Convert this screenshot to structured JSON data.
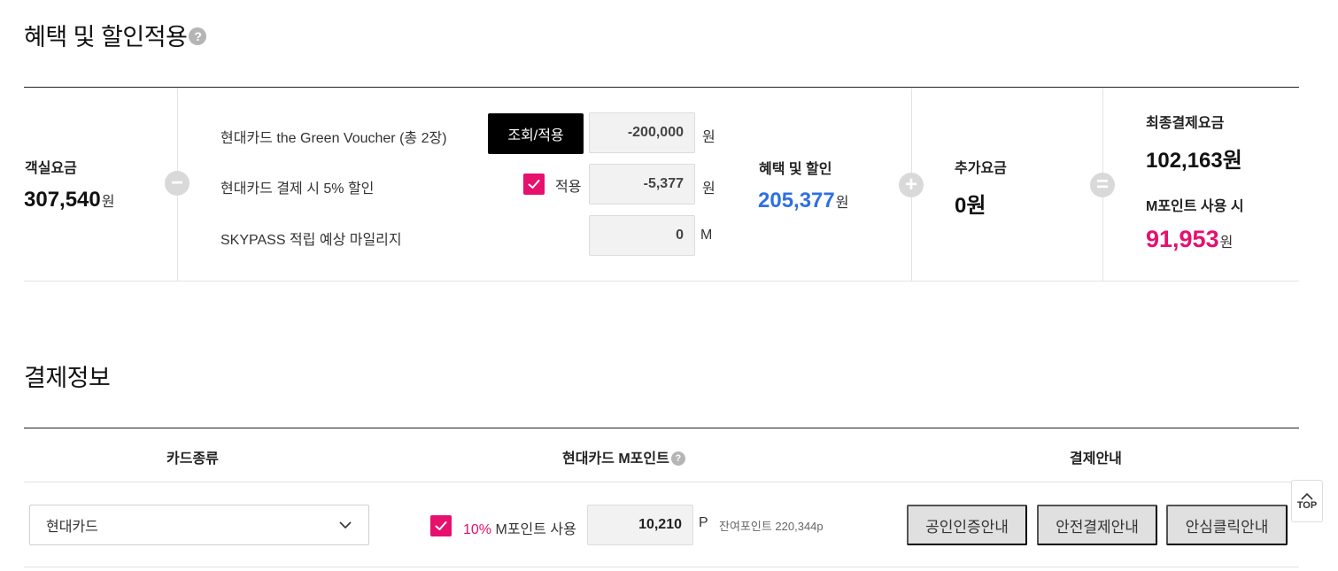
{
  "benefit_section": {
    "title": "혜택 및 할인적용",
    "help_icon": "?",
    "room_fee": {
      "label": "객실요금",
      "value": "307,540",
      "unit": "원"
    },
    "discounts": [
      {
        "label": "현대카드 the Green Voucher (총 2장)",
        "button": "조회/적용",
        "value": "-200,000",
        "unit": "원"
      },
      {
        "label": "현대카드 결제 시 5% 할인",
        "checkbox_label": "적용",
        "checked": true,
        "value": "-5,377",
        "unit": "원"
      },
      {
        "label": "SKYPASS 적립 예상 마일리지",
        "value": "0",
        "unit": "M"
      }
    ],
    "benefit_total": {
      "label": "혜택 및 할인",
      "value": "205,377",
      "unit": "원"
    },
    "extra_fee": {
      "label": "추가요금",
      "value": "0원"
    },
    "final": {
      "label": "최종결제요금",
      "value": "102,163원",
      "mpoint_label": "M포인트 사용 시",
      "mpoint_value": "91,953",
      "mpoint_unit": "원"
    },
    "colors": {
      "blue": "#2f6fe4",
      "pink": "#e6106d"
    }
  },
  "payment_section": {
    "title": "결제정보",
    "headers": {
      "card_type": "카드종류",
      "mpoint": "현대카드 M포인트",
      "guide": "결제안내"
    },
    "card_select": {
      "value": "현대카드"
    },
    "mpoint": {
      "percent": "10%",
      "label": "M포인트 사용",
      "value": "10,210",
      "unit": "P",
      "remaining": "잔여포인트 220,344p",
      "checked": true
    },
    "guide_buttons": [
      "공인인증안내",
      "안전결제안내",
      "안심클릭안내"
    ]
  },
  "top_button": "TOP"
}
